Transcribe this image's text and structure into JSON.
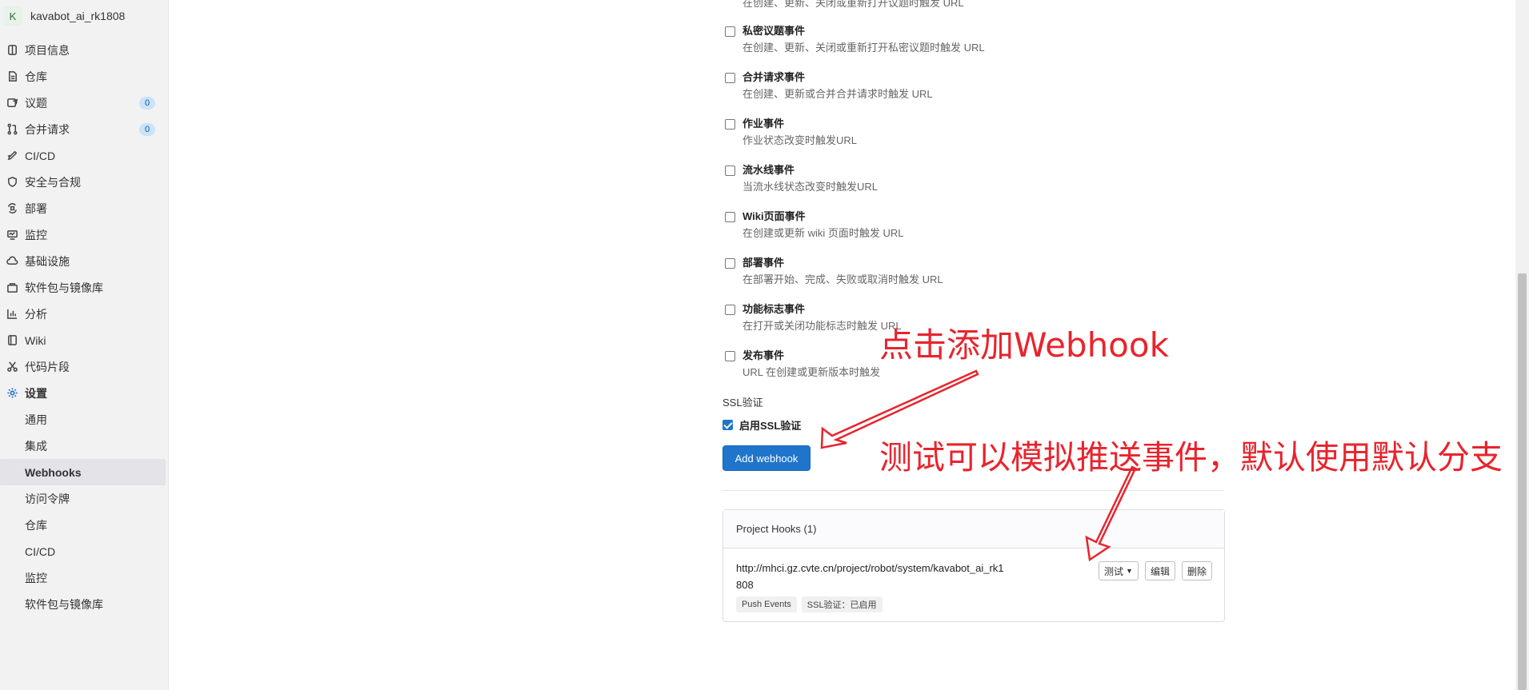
{
  "project": {
    "avatar_letter": "K",
    "name": "kavabot_ai_rk1808"
  },
  "sidebar": {
    "items": [
      {
        "label": "项目信息",
        "icon": "project-icon"
      },
      {
        "label": "仓库",
        "icon": "document-icon"
      },
      {
        "label": "议题",
        "icon": "issues-icon",
        "badge": "0"
      },
      {
        "label": "合并请求",
        "icon": "merge-request-icon",
        "badge": "0"
      },
      {
        "label": "CI/CD",
        "icon": "rocket-icon"
      },
      {
        "label": "安全与合规",
        "icon": "shield-icon"
      },
      {
        "label": "部署",
        "icon": "deployments-icon"
      },
      {
        "label": "监控",
        "icon": "monitor-icon"
      },
      {
        "label": "基础设施",
        "icon": "cloud-icon"
      },
      {
        "label": "软件包与镜像库",
        "icon": "package-icon"
      },
      {
        "label": "分析",
        "icon": "chart-icon"
      },
      {
        "label": "Wiki",
        "icon": "book-icon"
      },
      {
        "label": "代码片段",
        "icon": "scissors-icon"
      },
      {
        "label": "设置",
        "icon": "gear-icon"
      }
    ],
    "settings_subitems": [
      {
        "label": "通用"
      },
      {
        "label": "集成"
      },
      {
        "label": "Webhooks"
      },
      {
        "label": "访问令牌"
      },
      {
        "label": "仓库"
      },
      {
        "label": "CI/CD"
      },
      {
        "label": "监控"
      },
      {
        "label": "软件包与镜像库"
      }
    ]
  },
  "events": [
    {
      "title": "",
      "desc": "在创建、更新、关闭或重新打开议题时触发 URL"
    },
    {
      "title": "私密议题事件",
      "desc": "在创建、更新、关闭或重新打开私密议题时触发 URL"
    },
    {
      "title": "合并请求事件",
      "desc": "在创建、更新或合并合并请求时触发 URL"
    },
    {
      "title": "作业事件",
      "desc": "作业状态改变时触发URL"
    },
    {
      "title": "流水线事件",
      "desc": "当流水线状态改变时触发URL"
    },
    {
      "title": "Wiki页面事件",
      "desc": "在创建或更新 wiki 页面时触发 URL"
    },
    {
      "title": "部署事件",
      "desc": "在部署开始、完成、失败或取消时触发 URL"
    },
    {
      "title": "功能标志事件",
      "desc": "在打开或关闭功能标志时触发 URL"
    },
    {
      "title": "发布事件",
      "desc": "URL 在创建或更新版本时触发"
    }
  ],
  "ssl": {
    "section_label": "SSL验证",
    "checkbox_label": "启用SSL验证",
    "checked": true
  },
  "add_button_label": "Add webhook",
  "hooks": {
    "header": "Project Hooks (1)",
    "url": "http://mhci.gz.cvte.cn/project/robot/system/kavabot_ai_rk1808",
    "tags": [
      "Push Events",
      "SSL验证：已启用"
    ],
    "test_label": "测试",
    "edit_label": "编辑",
    "delete_label": "删除"
  },
  "annotations": {
    "add_hint": "点击添加Webhook",
    "test_hint": "测试可以模拟推送事件，默认使用默认分支",
    "color": "#e8242d"
  }
}
